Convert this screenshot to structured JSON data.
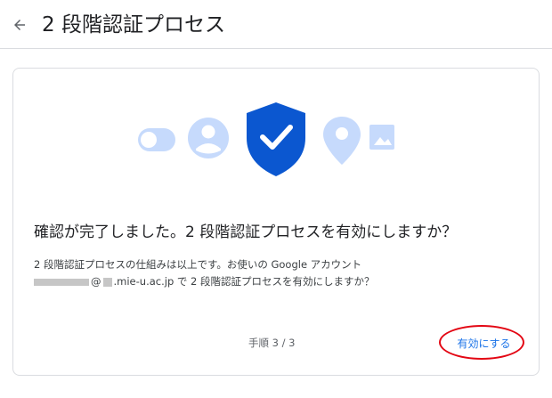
{
  "header": {
    "back_icon": "arrow-back-icon",
    "title": "2 段階認証プロセス"
  },
  "illustration": {
    "icons": [
      "toggle-icon",
      "account-icon",
      "shield-check-icon",
      "location-pin-icon",
      "image-icon"
    ],
    "colors": {
      "light_blue": "#c6dafc",
      "shield_blue": "#1a73e8",
      "check": "#ffffff"
    }
  },
  "card": {
    "heading": "確認が完了しました。2 段階認証プロセスを有効にしますか？",
    "description_line1": "2 段階認証プロセスの仕組みは以上です。お使いの Google アカウント",
    "account_at": "@",
    "account_domain": ".mie-u.ac.jp",
    "description_line2_suffix": " で 2 段階認証プロセスを有効にしますか？",
    "step": "手順 3 / 3",
    "enable_button": "有効にする"
  },
  "colors": {
    "accent": "#1a73e8",
    "divider": "#dadce0",
    "annotation": "#e30613"
  }
}
